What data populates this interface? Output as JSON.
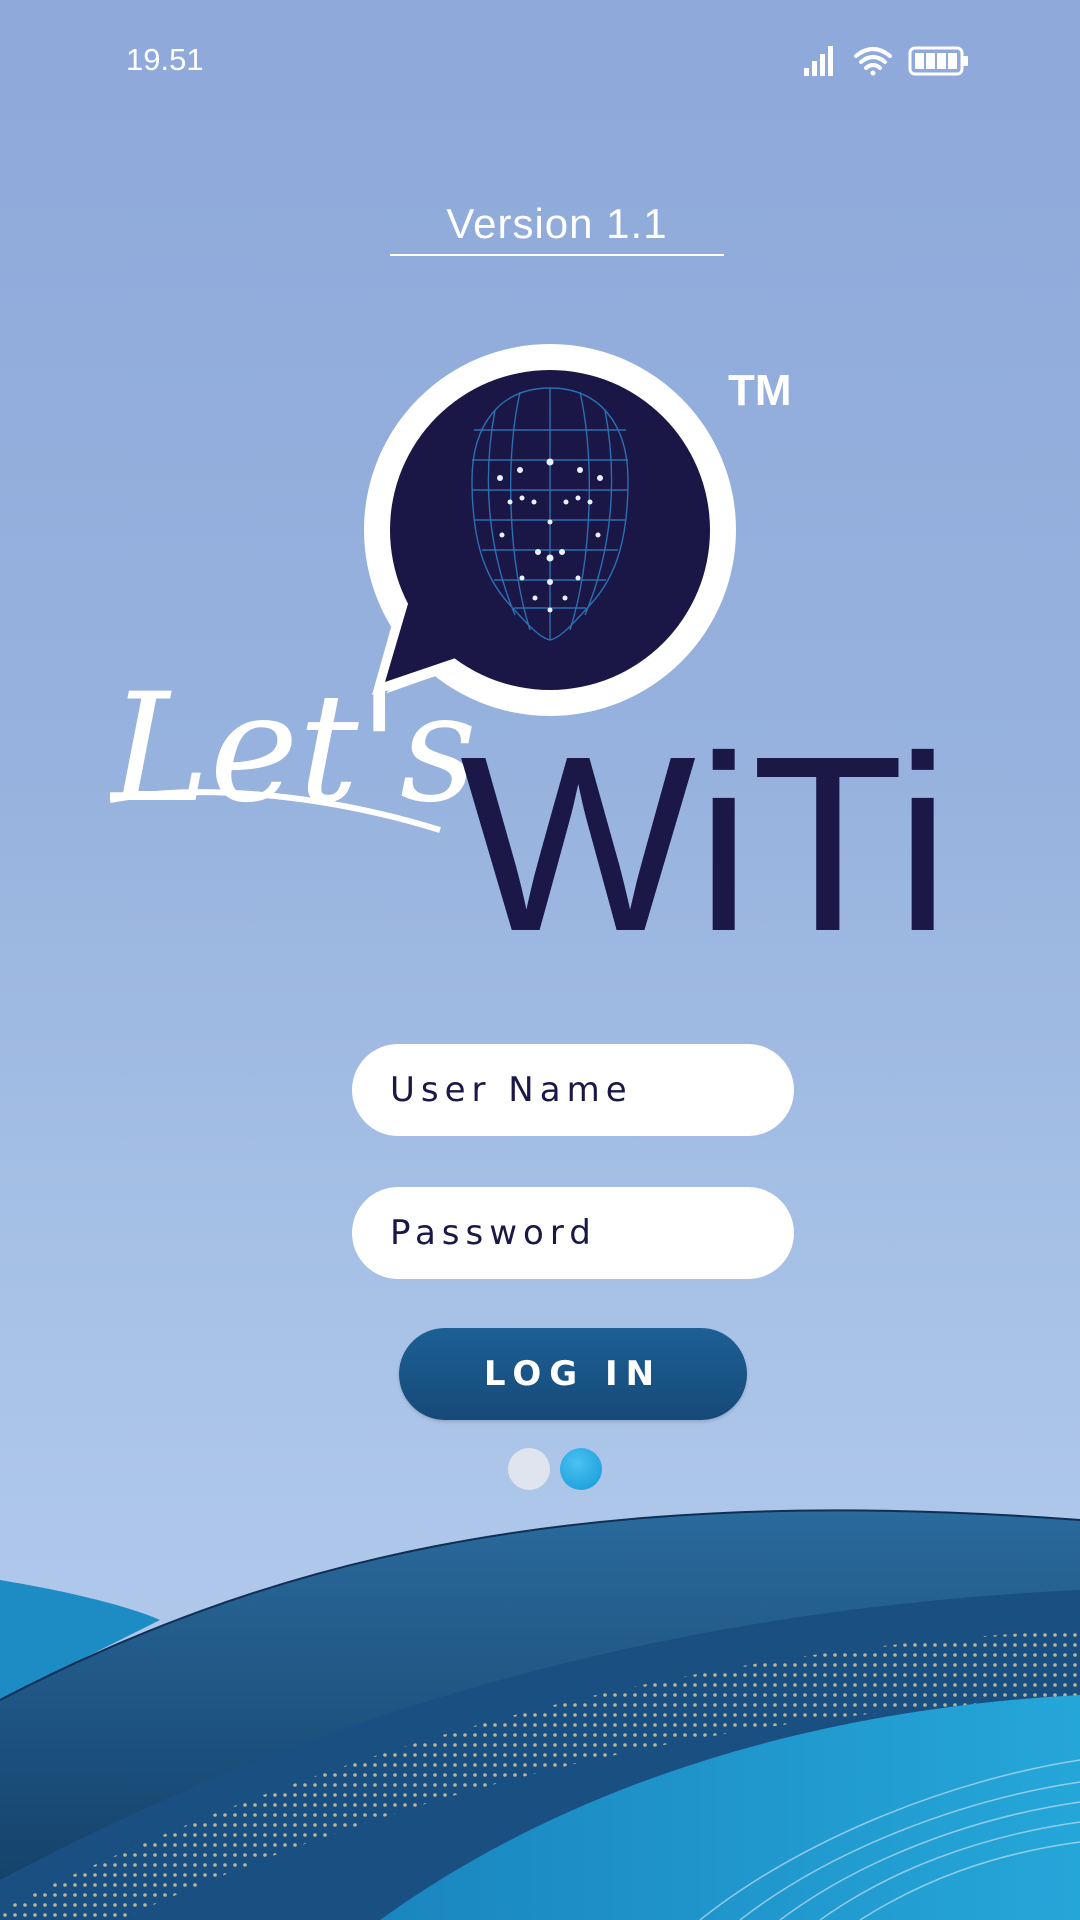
{
  "status_bar": {
    "time": "19.51",
    "icons": [
      "signal-icon",
      "wifi-icon",
      "battery-icon"
    ]
  },
  "version": {
    "label": "Version  1.1"
  },
  "logo": {
    "script_text": "Let's",
    "brand_text": "WiTi",
    "trademark": "TM",
    "icon": "face-scan-chat-bubble-icon",
    "colors": {
      "brand_dark": "#1b1847",
      "bubble": "#ffffff"
    }
  },
  "login_form": {
    "username_placeholder": "User Name",
    "password_placeholder": "Password",
    "login_label": "LOG IN"
  },
  "theme": {
    "background_top": "#8ea9da",
    "background_bottom": "#b6cdee",
    "button": "#1a5788",
    "accent": "#1e9fd6"
  }
}
